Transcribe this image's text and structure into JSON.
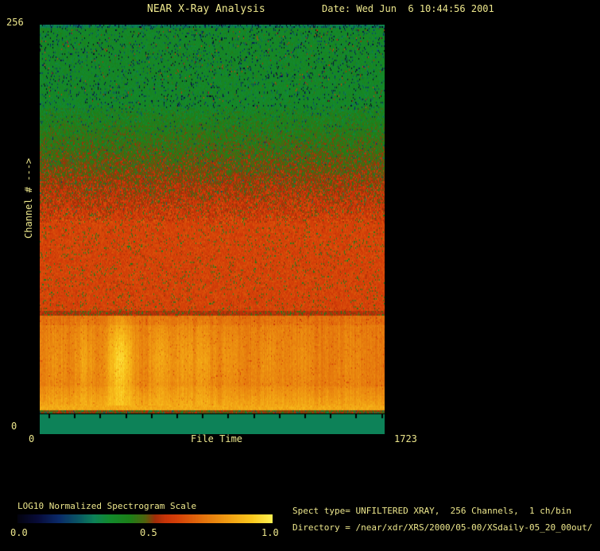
{
  "window": {
    "title": "NEAR X-Ray Analysis",
    "date": "Date: Wed Jun  6 10:44:56 2001"
  },
  "colors": {
    "background": "#000000",
    "text": "#EDE78C",
    "quiet_band_teal": "#0D8258"
  },
  "axes": {
    "y_max": "256",
    "y_min": "0",
    "y_title": "Channel # --->",
    "x_min": "0",
    "x_title": "File Time",
    "x_max": "1723"
  },
  "colorbar": {
    "title": "LOG10 Normalized Spectrogram Scale",
    "ticks": [
      "0.0",
      "0.5",
      "1.0"
    ]
  },
  "info": {
    "spect_type": "Spect type= UNFILTERED XRAY,  256 Channels,  1 ch/bin",
    "directory": "Directory = /near/xdr/XRS/2000/05-00/XSdaily-05_20_00out/"
  },
  "chart_data": {
    "type": "heatmap",
    "title": "NEAR X-Ray Analysis",
    "xlabel": "File Time",
    "ylabel": "Channel #",
    "xlim": [
      0,
      1723
    ],
    "ylim": [
      0,
      256
    ],
    "grid": false,
    "legend": "none",
    "colorbar": {
      "label": "LOG10 Normalized Spectrogram Scale",
      "ticks": [
        0.0,
        0.5,
        1.0
      ],
      "scale": "log10 normalized",
      "position": "bottom-left"
    },
    "colormap_stops": [
      [
        0.0,
        [
          3,
          3,
          15
        ]
      ],
      [
        0.08,
        [
          8,
          12,
          58
        ]
      ],
      [
        0.16,
        [
          10,
          42,
          105
        ]
      ],
      [
        0.24,
        [
          10,
          88,
          100
        ]
      ],
      [
        0.3,
        [
          13,
          130,
          88
        ]
      ],
      [
        0.36,
        [
          18,
          138,
          45
        ]
      ],
      [
        0.44,
        [
          28,
          128,
          24
        ]
      ],
      [
        0.5,
        [
          80,
          100,
          14
        ]
      ],
      [
        0.54,
        [
          160,
          45,
          8
        ]
      ],
      [
        0.58,
        [
          200,
          52,
          8
        ]
      ],
      [
        0.62,
        [
          212,
          62,
          8
        ]
      ],
      [
        0.72,
        [
          226,
          110,
          12
        ]
      ],
      [
        0.82,
        [
          240,
          155,
          18
        ]
      ],
      [
        0.92,
        [
          250,
          200,
          30
        ]
      ],
      [
        1.0,
        [
          255,
          240,
          80
        ]
      ]
    ],
    "bands": [
      {
        "channel_range": [
          0,
          13
        ],
        "norm_value": 0.3,
        "flat": true,
        "appearance": "uniform teal quiet band at bottom"
      },
      {
        "channel_range": [
          13,
          15
        ],
        "norm_value": 0.53,
        "noise": 0.06,
        "speck_p": 0.3,
        "speck_d": 0.3,
        "appearance": "dark maroon boundary line"
      },
      {
        "channel_range": [
          15,
          18
        ],
        "norm_value": 0.85,
        "noise": 0.05,
        "appearance": "bright yellow-orange row"
      },
      {
        "channel_range": [
          18,
          30
        ],
        "norm_value_bottom": 0.83,
        "norm_value_top": 0.76,
        "noise": 0.035,
        "speck_p": 0.04,
        "speck_d": 0.12,
        "streaky": true,
        "events": true,
        "appearance": "lower orange band brightening toward bottom"
      },
      {
        "channel_range": [
          30,
          68
        ],
        "norm_value": 0.745,
        "noise": 0.035,
        "speck_p": 0.05,
        "speck_d": 0.14,
        "streaky": true,
        "events": true,
        "appearance": "orange band with bright transient events"
      },
      {
        "channel_range": [
          68,
          74
        ],
        "norm_value": 0.72,
        "noise": 0.04,
        "speck_p": 0.06,
        "speck_d": 0.15,
        "streaky": true,
        "events": true,
        "appearance": "top edge of orange band"
      },
      {
        "channel_range": [
          74,
          77
        ],
        "norm_value": 0.56,
        "noise": 0.05,
        "speck_p": 0.2,
        "speck_d": 0.2,
        "appearance": "dark red boundary above orange band"
      },
      {
        "channel_range": [
          77,
          132
        ],
        "norm_value": 0.63,
        "noise": 0.055,
        "speck_p": 0.09,
        "speck_d": 0.26,
        "appearance": "red noisy region"
      },
      {
        "channel_range": [
          132,
          204
        ],
        "norm_value_bottom": 0.62,
        "norm_value_top": 0.4,
        "noise": 0.1,
        "speck_p": 0.08,
        "speck_d": 0.28,
        "appearance": "chunky red-to-green transition"
      },
      {
        "channel_range": [
          204,
          254
        ],
        "norm_value": 0.385,
        "noise": 0.05,
        "speck_p": 0.12,
        "speck_d": 0.36,
        "hot_p": 0.03,
        "hot_a": 0.22,
        "appearance": "green noisy region with dark speckles"
      },
      {
        "channel_range": [
          254,
          256
        ],
        "norm_value": 0.31,
        "noise": 0.06,
        "speck_p": 0.25,
        "speck_d": 0.3,
        "appearance": "teal-tinged top edge"
      }
    ],
    "events": [
      {
        "file_time": 87,
        "amplitude": 0.06,
        "sigma_ft": 40,
        "channel_center": 45,
        "channel_sigma": 19
      },
      {
        "file_time": 222,
        "amplitude": 0.09,
        "sigma_ft": 36,
        "channel_center": 45,
        "channel_sigma": 19
      },
      {
        "file_time": 401,
        "amplitude": 0.2,
        "sigma_ft": 48,
        "channel_center": 45,
        "channel_sigma": 21
      },
      {
        "file_time": 604,
        "amplitude": 0.1,
        "sigma_ft": 50,
        "channel_center": 45,
        "channel_sigma": 19
      },
      {
        "file_time": 727,
        "amplitude": 0.07,
        "sigma_ft": 32,
        "channel_center": 45,
        "channel_sigma": 18
      },
      {
        "file_time": 818,
        "amplitude": 0.08,
        "sigma_ft": 36,
        "channel_center": 45,
        "channel_sigma": 18
      },
      {
        "file_time": 953,
        "amplitude": 0.06,
        "sigma_ft": 46,
        "channel_center": 45,
        "channel_sigma": 18
      },
      {
        "file_time": 1131,
        "amplitude": 0.05,
        "sigma_ft": 46,
        "channel_center": 45,
        "channel_sigma": 17
      },
      {
        "file_time": 1310,
        "amplitude": 0.04,
        "sigma_ft": 55,
        "channel_center": 45,
        "channel_sigma": 17
      },
      {
        "file_time": 1548,
        "amplitude": 0.035,
        "sigma_ft": 55,
        "channel_center": 45,
        "channel_sigma": 17
      }
    ],
    "render": {
      "seed": 42,
      "x_tick_start": 11,
      "x_tick_step": 32.2,
      "x_tick_count": 14
    }
  }
}
